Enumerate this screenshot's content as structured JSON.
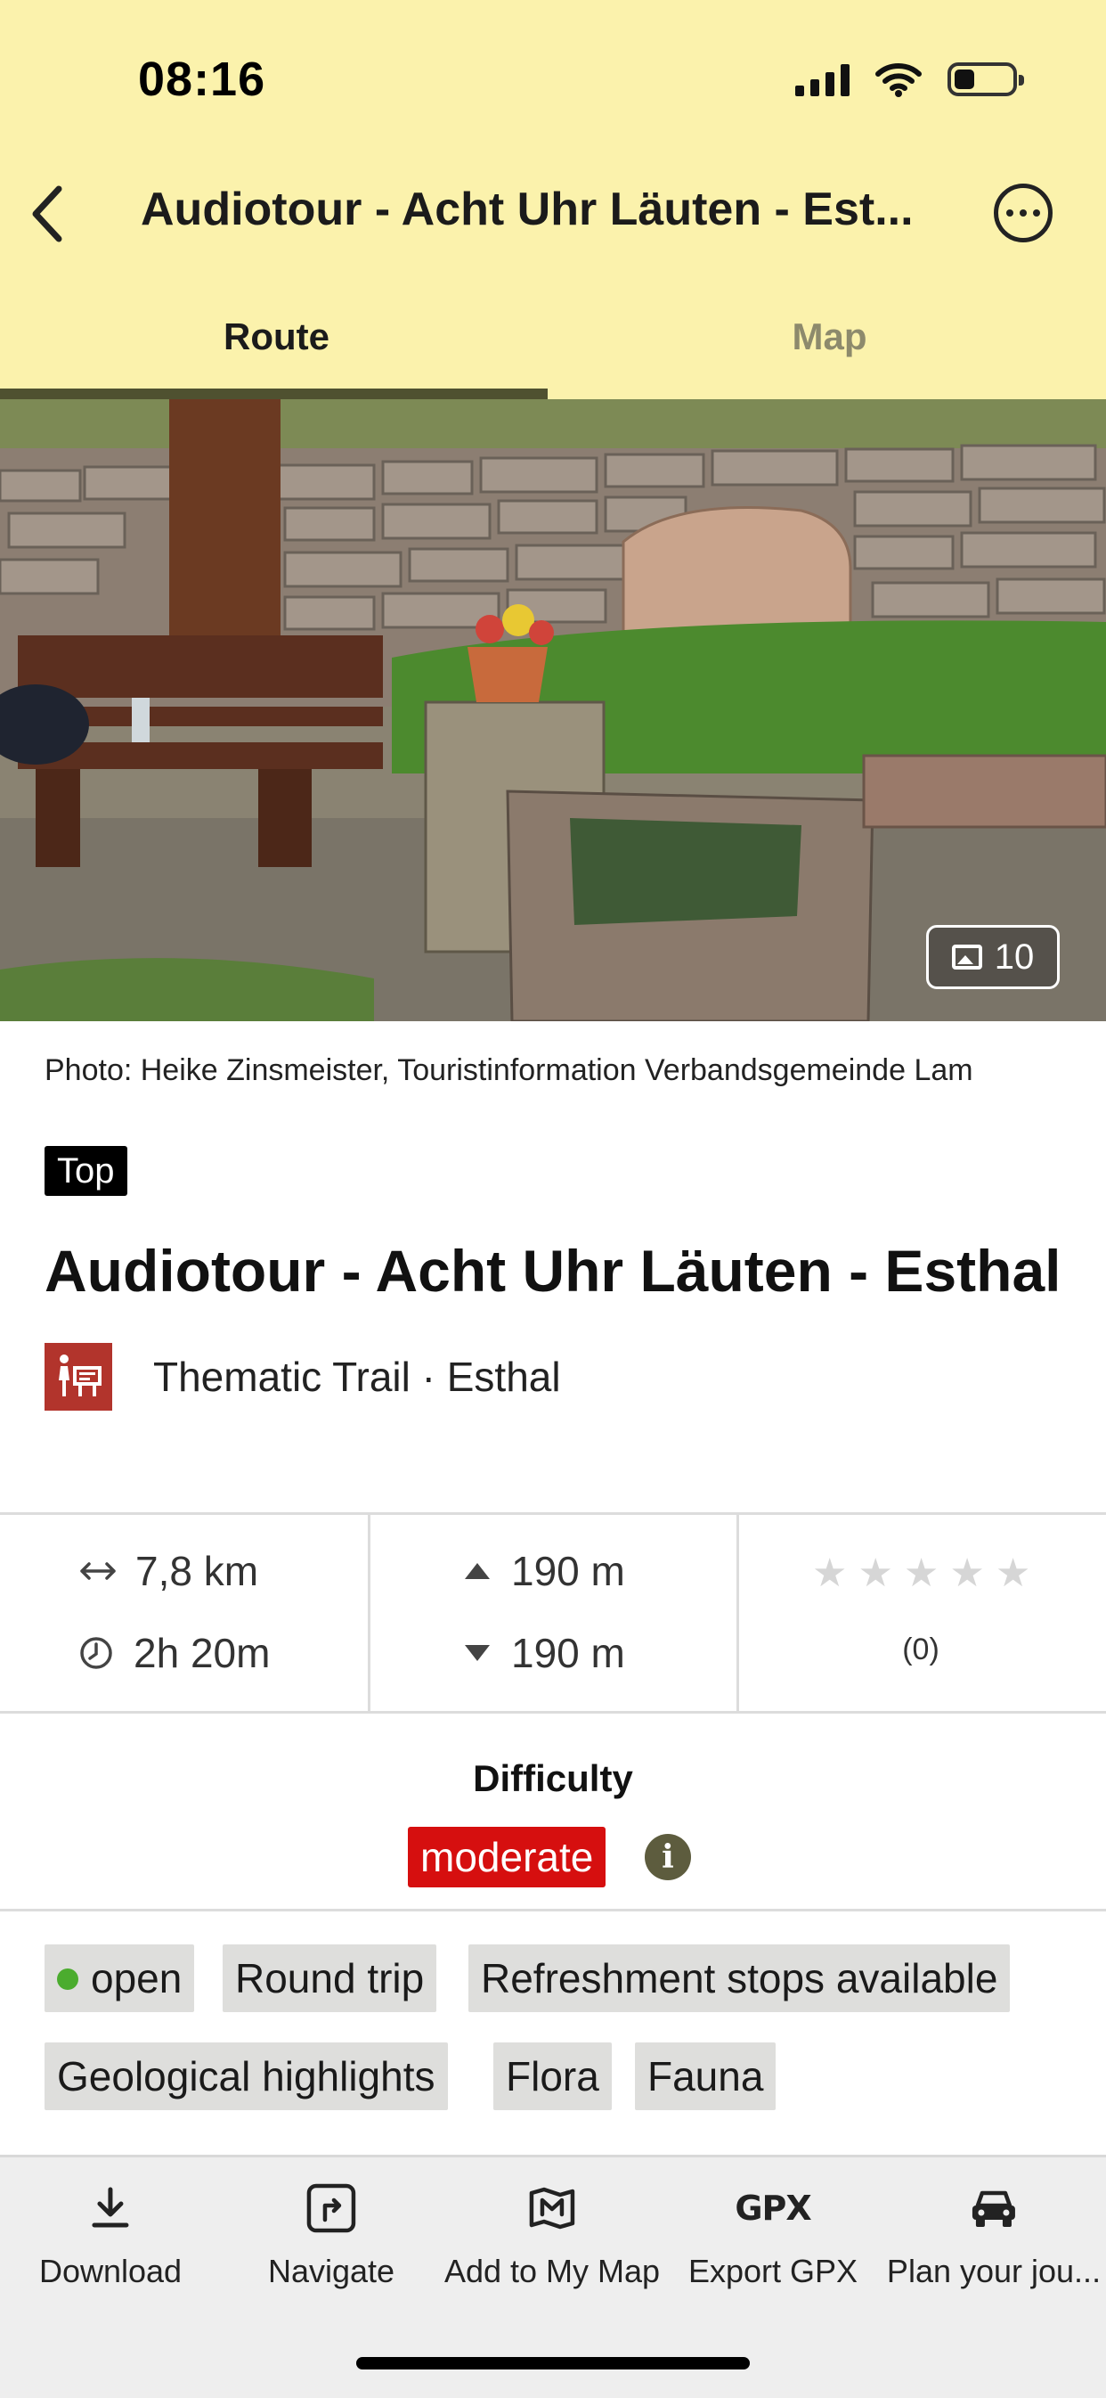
{
  "status_bar": {
    "time": "08:16"
  },
  "nav": {
    "title": "Audiotour - Acht Uhr Läuten - Est..."
  },
  "tabs": [
    {
      "label": "Route"
    },
    {
      "label": "Map"
    }
  ],
  "photo": {
    "gallery_count": "10"
  },
  "caption": "Photo: Heike Zinsmeister, Touristinformation Verbandsgemeinde Lam",
  "badge": "Top",
  "title": "Audiotour - Acht Uhr Läuten - Esthal",
  "category": "Thematic Trail · Esthal",
  "stats": {
    "distance": "7,8 km",
    "duration": "2h 20m",
    "ascent": "190 m",
    "descent": "190 m",
    "rating_count": "(0)",
    "rating_value": 0,
    "rating_max": 5
  },
  "difficulty": {
    "label": "Difficulty",
    "value": "moderate"
  },
  "tags": {
    "row1": [
      "open",
      "Round trip",
      "Refreshment stops available"
    ],
    "row2": [
      "Geological highlights",
      "Flora",
      "Fauna"
    ]
  },
  "bottom_bar": [
    {
      "label": "Download",
      "icon": "download-icon"
    },
    {
      "label": "Navigate",
      "icon": "navigate-icon"
    },
    {
      "label": "Add to My Map",
      "icon": "map-icon"
    },
    {
      "label": "Export GPX",
      "icon": "gpx-icon",
      "icon_text": "GPX"
    },
    {
      "label": "Plan your jou...",
      "icon": "car-icon"
    }
  ],
  "colors": {
    "header_bg": "#fbf2ac",
    "tab_underline": "#4f5130",
    "difficulty_red": "#d60f0f",
    "status_open_green": "#4bac2e",
    "category_icon_bg": "#b2342c"
  }
}
